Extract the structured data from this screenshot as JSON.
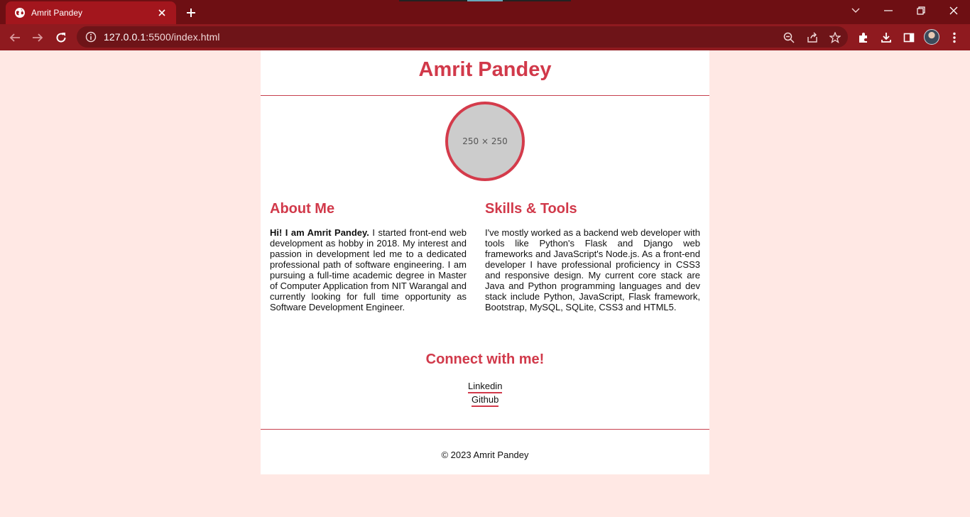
{
  "browser": {
    "tab_title": "Amrit Pandey",
    "url_host": "127.0.0.1",
    "url_rest": ":5500/index.html",
    "colors": {
      "tabbar": "#6e0f13",
      "toolbar": "#8f1a1f",
      "omnibox": "#6e1418"
    }
  },
  "page": {
    "title": "Amrit Pandey",
    "avatar_placeholder": "250 × 250",
    "about": {
      "heading": "About Me",
      "intro_bold": "Hi! I am Amrit Pandey.",
      "text": " I started front-end web development as hobby in 2018. My interest and passion in development led me to a dedicated professional path of software engineering. I am pursuing a full-time academic degree in Master of Computer Application from NIT Warangal and currently looking for full time opportunity as Software Development Engineer."
    },
    "skills": {
      "heading": "Skills & Tools",
      "text": "I've mostly worked as a backend web developer with tools like Python's Flask and Django web frameworks and JavaScript's Node.js. As a front-end developer I have professional proficiency in CSS3 and responsive design. My current core stack are Java and Python programming languages and dev stack include Python, JavaScript, Flask framework, Bootstrap, MySQL, SQLite, CSS3 and HTML5."
    },
    "connect": {
      "heading": "Connect with me!",
      "links": [
        "Linkedin",
        "Github"
      ]
    },
    "footer": "© 2023 Amrit Pandey",
    "colors": {
      "accent": "#d1394a",
      "background": "#ffe8e4"
    }
  }
}
